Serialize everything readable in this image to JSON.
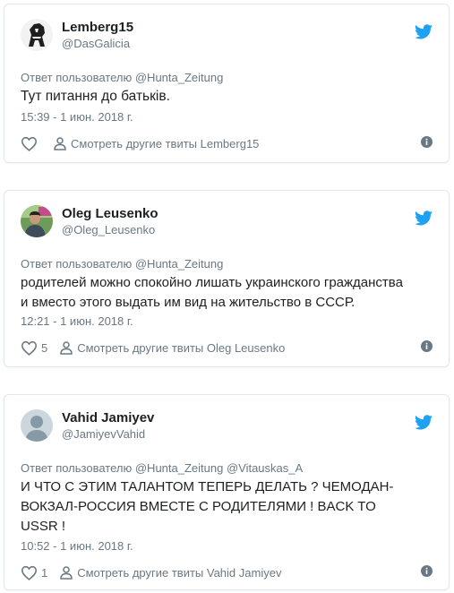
{
  "colors": {
    "twitter_blue": "#1da1f2",
    "secondary_text": "#697882",
    "primary_text": "#1c2022",
    "border": "#e1e8ed"
  },
  "tweets": [
    {
      "display_name": "Lemberg15",
      "handle": "@DasGalicia",
      "reply_prefix": "Ответ пользователю",
      "reply_to": "@Hunta_Zeitung",
      "text": "Тут питання до батьків.",
      "timestamp": "15:39 - 1 июн. 2018 г.",
      "like_count": "",
      "more_label": "Смотреть другие твиты Lemberg15",
      "avatar_icon": "dark-figure-avatar"
    },
    {
      "display_name": "Oleg Leusenko",
      "handle": "@Oleg_Leusenko",
      "reply_prefix": "Ответ пользователю",
      "reply_to": "@Hunta_Zeitung",
      "text": "родителей можно спокойно лишать украинского гражданства\nи вместо этого выдать им вид на жительство в СССР.",
      "timestamp": "12:21 - 1 июн. 2018 г.",
      "like_count": "5",
      "more_label": "Смотреть другие твиты Oleg Leusenko",
      "avatar_icon": "photo-avatar"
    },
    {
      "display_name": "Vahid Jamiyev",
      "handle": "@JamiyevVahid",
      "reply_prefix": "Ответ пользователю",
      "reply_to": "@Hunta_Zeitung @Vitauskas_A",
      "text": "И ЧТО С ЭТИМ ТАЛАНТОМ ТЕПЕРЬ ДЕЛАТЬ ?  ЧЕМОДАН-\nВОКЗАЛ-РОССИЯ  ВМЕСТЕ С РОДИТЕЛЯМИ ! BACK TO\nUSSR !",
      "timestamp": "10:52 - 1 июн. 2018 г.",
      "like_count": "1",
      "more_label": "Смотреть другие твиты Vahid Jamiyev",
      "avatar_icon": "default-avatar"
    }
  ]
}
